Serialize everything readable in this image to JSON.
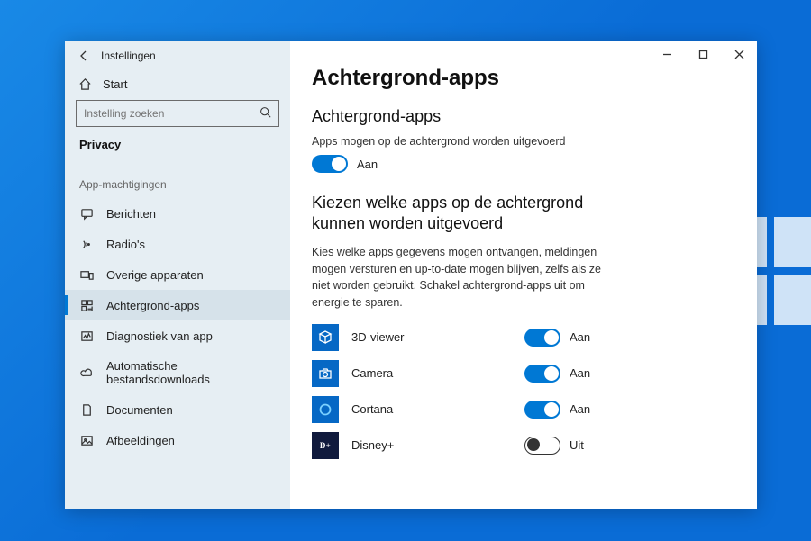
{
  "window": {
    "title": "Instellingen"
  },
  "sidebar": {
    "home": "Start",
    "search_placeholder": "Instelling zoeken",
    "category": "Privacy",
    "section": "App-machtigingen",
    "items": [
      {
        "label": "Berichten",
        "icon": "message"
      },
      {
        "label": "Radio's",
        "icon": "radio"
      },
      {
        "label": "Overige apparaten",
        "icon": "devices"
      },
      {
        "label": "Achtergrond-apps",
        "icon": "grid",
        "selected": true
      },
      {
        "label": "Diagnostiek van app",
        "icon": "diag"
      },
      {
        "label": "Automatische bestandsdownloads",
        "icon": "cloud"
      },
      {
        "label": "Documenten",
        "icon": "doc"
      },
      {
        "label": "Afbeeldingen",
        "icon": "image"
      }
    ]
  },
  "main": {
    "heading": "Achtergrond-apps",
    "sub1": "Achtergrond-apps",
    "master_label": "Apps mogen op de achtergrond worden uitgevoerd",
    "master_state": "Aan",
    "sub2": "Kiezen welke apps op de achtergrond kunnen worden uitgevoerd",
    "desc": "Kies welke apps gegevens mogen ontvangen, meldingen mogen versturen en up-to-date mogen blijven, zelfs als ze niet worden gebruikt. Schakel achtergrond-apps uit om energie te sparen.",
    "apps": [
      {
        "name": "3D-viewer",
        "state": "Aan",
        "on": true,
        "icon": "cube"
      },
      {
        "name": "Camera",
        "state": "Aan",
        "on": true,
        "icon": "camera"
      },
      {
        "name": "Cortana",
        "state": "Aan",
        "on": true,
        "icon": "ring"
      },
      {
        "name": "Disney+",
        "state": "Uit",
        "on": false,
        "icon": "disney"
      }
    ]
  }
}
